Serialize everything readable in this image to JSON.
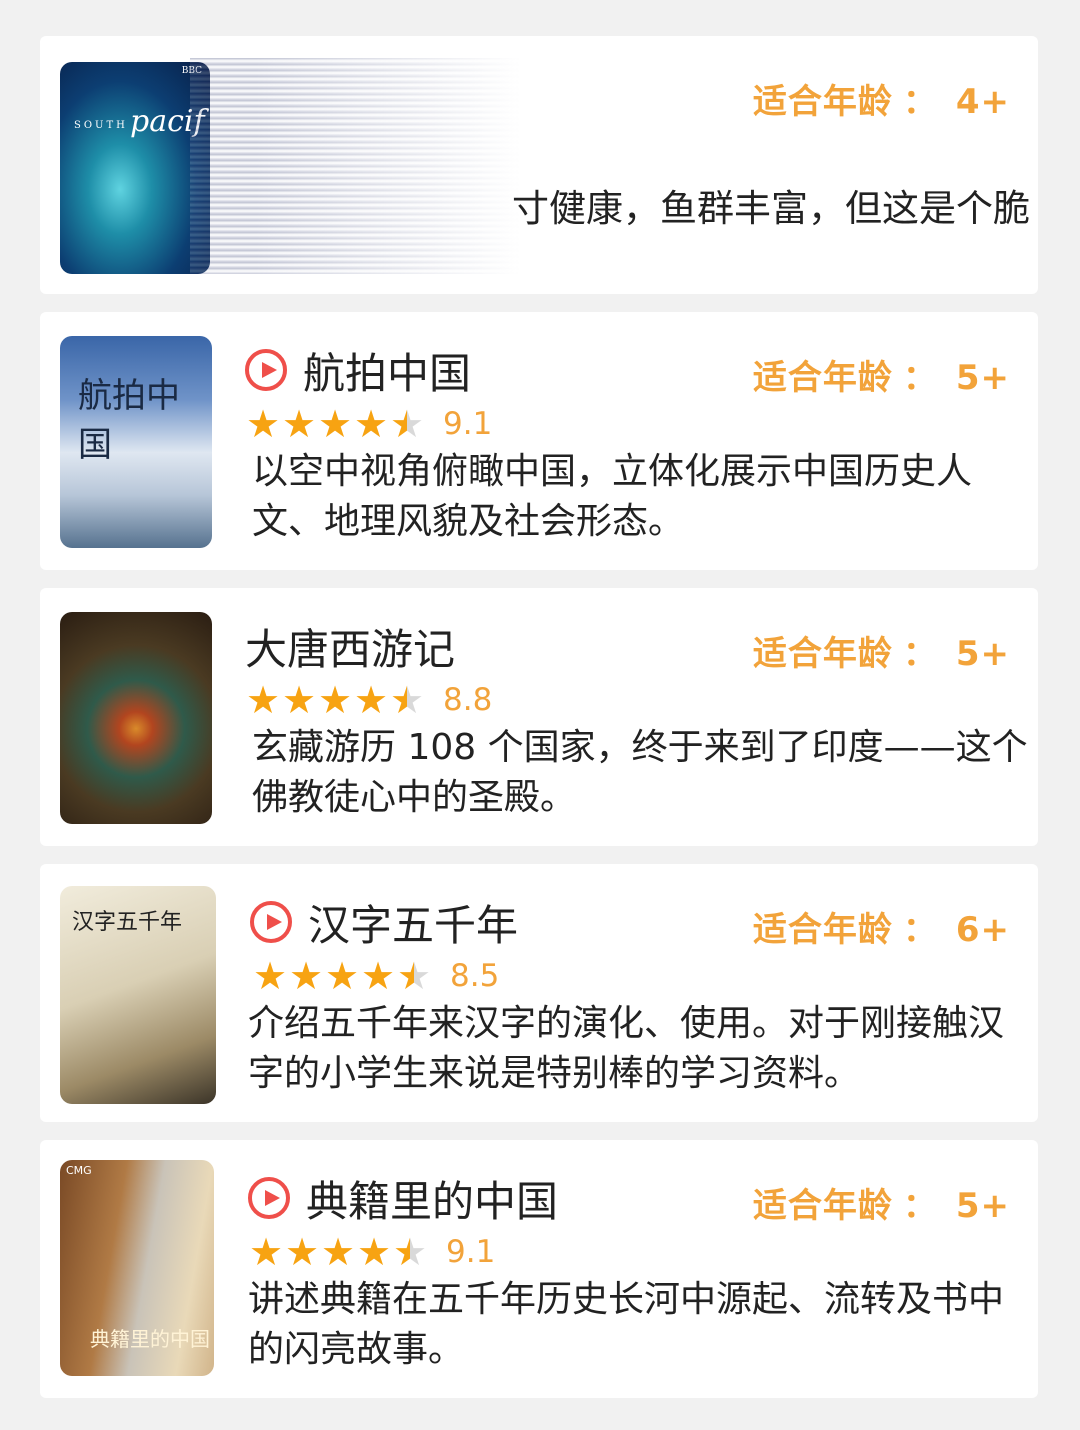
{
  "age_label": "适合年龄",
  "age_colon": "：",
  "cards": [
    {
      "age": "4+",
      "description": "寸健康，鱼群丰富，但这是个脆",
      "poster_brand": "BBC",
      "poster_title": "pacif",
      "poster_prefix": "SOUTH"
    },
    {
      "title": "航拍中国",
      "has_play_icon": true,
      "age": "5+",
      "score": "9.1",
      "stars": 4.5,
      "description": "以空中视角俯瞰中国，立体化展示中国历史人文、地理风貌及社会形态。"
    },
    {
      "title": "大唐西游记",
      "has_play_icon": false,
      "age": "5+",
      "score": "8.8",
      "stars": 4.5,
      "description": "玄藏游历 108 个国家，终于来到了印度——这个佛教徒心中的圣殿。"
    },
    {
      "title": "汉字五千年",
      "has_play_icon": true,
      "age": "6+",
      "score": "8.5",
      "stars": 4.5,
      "description": "介绍五千年来汉字的演化、使用。对于刚接触汉字的小学生来说是特别棒的学习资料。"
    },
    {
      "title": "典籍里的中国",
      "has_play_icon": true,
      "age": "5+",
      "score": "9.1",
      "stars": 4.5,
      "description": "讲述典籍在五千年历史长河中源起、流转及书中的闪亮故事。",
      "poster_brand": "CMG"
    }
  ],
  "star_glyph": "★",
  "colors": {
    "accent_orange": "#f2a33a",
    "star": "#f7a312",
    "play_red": "#ef4f4a"
  }
}
